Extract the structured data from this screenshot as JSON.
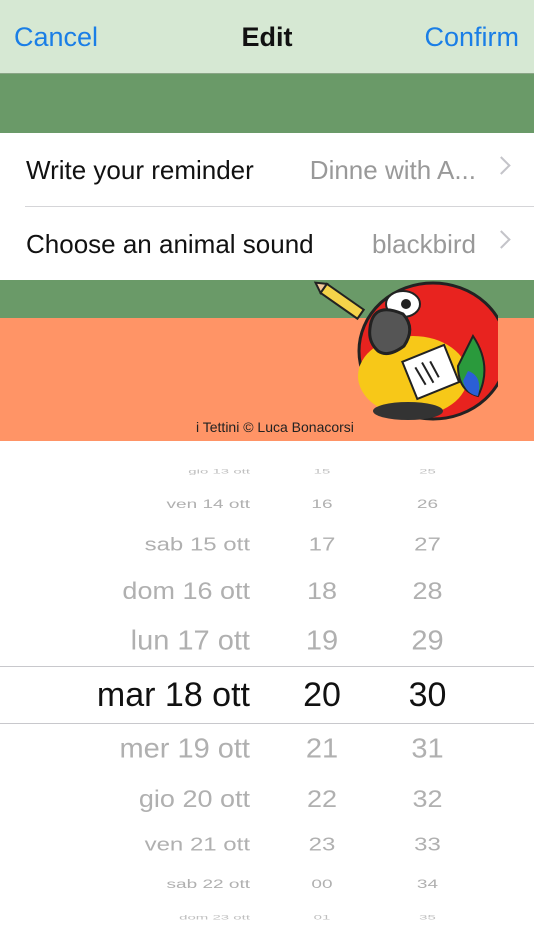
{
  "nav": {
    "cancel": "Cancel",
    "title": "Edit",
    "confirm": "Confirm"
  },
  "form": {
    "reminder_label": "Write your reminder",
    "reminder_value": "Dinne with A...",
    "sound_label": "Choose an animal sound",
    "sound_value": "blackbird"
  },
  "banner": {
    "credit": "i Tettini © Luca Bonacorsi"
  },
  "picker": {
    "rows": [
      {
        "date": "gio 13 ott",
        "hour": "15",
        "minute": "25"
      },
      {
        "date": "ven 14 ott",
        "hour": "16",
        "minute": "26"
      },
      {
        "date": "sab 15 ott",
        "hour": "17",
        "minute": "27"
      },
      {
        "date": "dom 16 ott",
        "hour": "18",
        "minute": "28"
      },
      {
        "date": "lun 17 ott",
        "hour": "19",
        "minute": "29"
      },
      {
        "date": "mar 18 ott",
        "hour": "20",
        "minute": "30"
      },
      {
        "date": "mer 19 ott",
        "hour": "21",
        "minute": "31"
      },
      {
        "date": "gio 20 ott",
        "hour": "22",
        "minute": "32"
      },
      {
        "date": "ven 21 ott",
        "hour": "23",
        "minute": "33"
      },
      {
        "date": "sab 22 ott",
        "hour": "00",
        "minute": "34"
      },
      {
        "date": "dom 23 ott",
        "hour": "01",
        "minute": "35"
      }
    ],
    "selected_index": 5
  }
}
